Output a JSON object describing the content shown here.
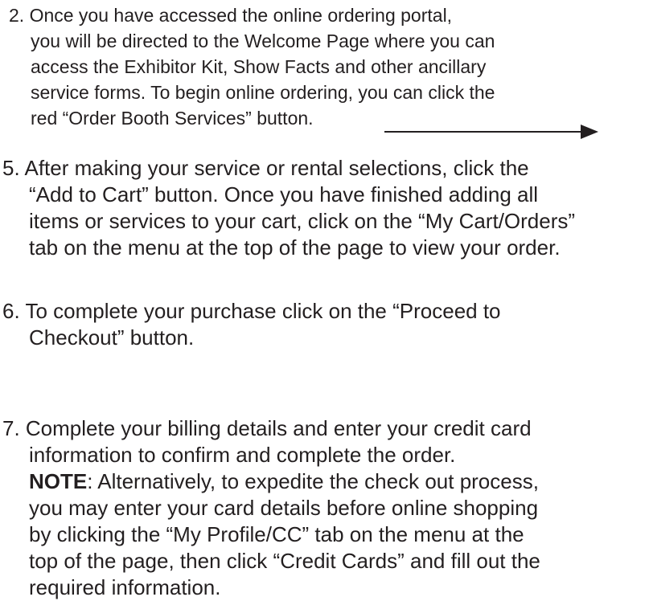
{
  "steps": [
    {
      "id": "2",
      "lines": [
        "2. Once you have accessed the online ordering portal,",
        "you will be directed to the Welcome Page where you can",
        "access the Exhibitor Kit, Show Facts and other ancillary",
        "service forms. To begin online ordering, you can click the",
        "red “Order Booth Services” button."
      ]
    },
    {
      "id": "5",
      "lines": [
        "5. After making your service or rental selections, click the",
        "“Add to Cart” button. Once you have finished adding all",
        "items or services to your cart, click on the “My Cart/Orders”",
        "tab on the menu at the top of the page to view your order."
      ]
    },
    {
      "id": "6",
      "lines": [
        "6. To complete your purchase click on the “Proceed to",
        "Checkout” button."
      ]
    },
    {
      "id": "7",
      "lines": [
        "7. Complete your billing details and enter your credit card",
        "information to confirm and complete the order."
      ],
      "note_label": "NOTE",
      "note_first_line": ": Alternatively, to expedite the check out process,",
      "note_lines": [
        "you may enter your card details before online shopping",
        "by clicking the “My Profile/CC” tab on the menu at the",
        "top of the page, then click “Credit Cards” and fill out the",
        "required information."
      ]
    }
  ],
  "icons": {
    "arrow": "arrow-right-icon",
    "color": "#231f20"
  }
}
